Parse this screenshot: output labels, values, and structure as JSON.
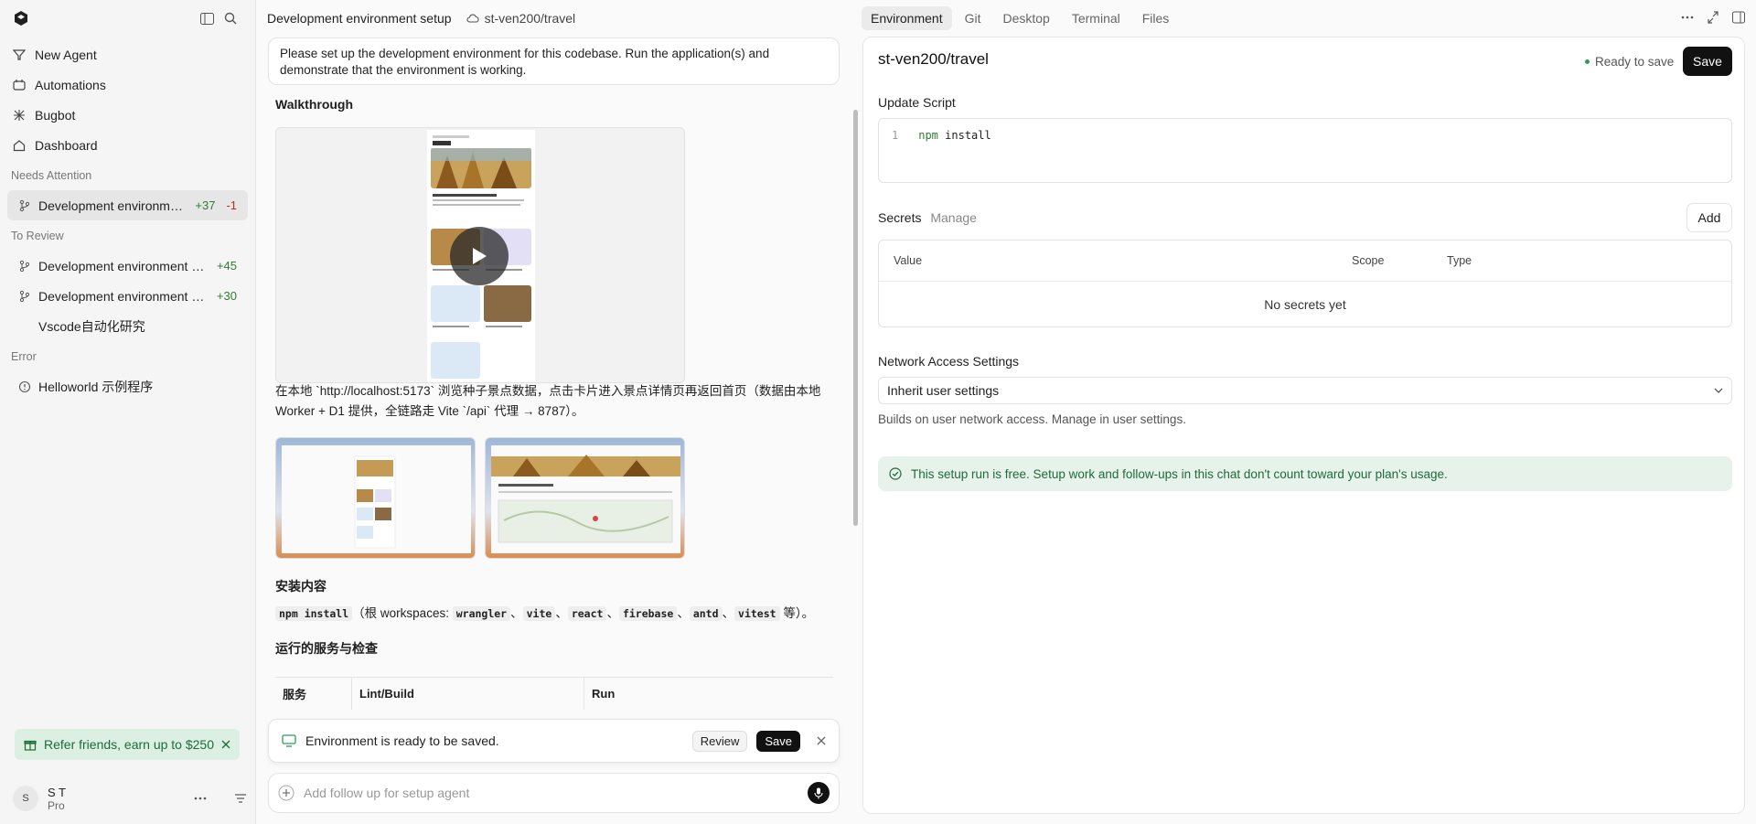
{
  "sidebar": {
    "nav": [
      {
        "label": "New Agent",
        "icon": "agent-icon"
      },
      {
        "label": "Automations",
        "icon": "automations-icon"
      },
      {
        "label": "Bugbot",
        "icon": "bug-icon"
      },
      {
        "label": "Dashboard",
        "icon": "home-icon"
      }
    ],
    "sections": {
      "needs_attention": "Needs Attention",
      "to_review": "To Review",
      "error": "Error"
    },
    "needs_attention_items": [
      {
        "label": "Development environment...",
        "plus": "+37",
        "minus": "-1"
      }
    ],
    "review_items": [
      {
        "label": "Development environment se...",
        "plus": "+45"
      },
      {
        "label": "Development environment se...",
        "plus": "+30"
      },
      {
        "label": "Vscode自动化研究"
      }
    ],
    "error_items": [
      {
        "label": "Helloworld 示例程序"
      }
    ],
    "promo": "Refer friends, earn up to $250",
    "user": {
      "initial": "S",
      "name": "S T",
      "plan": "Pro"
    }
  },
  "chat": {
    "title": "Development environment setup",
    "repo": "st-ven200/travel",
    "prompt": "Please set up the development environment for this codebase. Run the application(s) and demonstrate that the environment is working.",
    "walkthrough_title": "Walkthrough",
    "desc_line1": "在本地 `http://localhost:5173` 浏览种子景点数据，点击卡片进入景点详情页再返回首页（数据由本地",
    "desc_line2": "Worker + D1 提供，全链路走 Vite `/api` 代理 → 8787）。",
    "install_title": "安装内容",
    "install_cmd": "npm install",
    "install_mid": "（根 workspaces:",
    "packages": [
      "wrangler",
      "vite",
      "react",
      "firebase",
      "antd",
      "vitest"
    ],
    "install_end": "等）。",
    "services_title": "运行的服务与检查",
    "table_headers": [
      "服务",
      "Lint/Build",
      "Run"
    ],
    "toast_text": "Environment is ready to be saved.",
    "toast_review": "Review",
    "toast_save": "Save",
    "composer_placeholder": "Add follow up for setup agent"
  },
  "right": {
    "tabs": [
      "Environment",
      "Git",
      "Desktop",
      "Terminal",
      "Files"
    ],
    "title": "st-ven200/travel",
    "status": "Ready to save",
    "save": "Save",
    "update_script_label": "Update Script",
    "script_line_no": "1",
    "script_cmd": "npm",
    "script_arg": "install",
    "secrets_label": "Secrets",
    "secrets_manage": "Manage",
    "add": "Add",
    "secrets_columns": [
      "Value",
      "Scope",
      "Type"
    ],
    "secrets_empty": "No secrets yet",
    "network_label": "Network Access Settings",
    "network_value": "Inherit user settings",
    "network_help": "Builds on user network access. Manage in",
    "network_help_link": "user settings.",
    "banner": "This setup run is free. Setup work and follow-ups in this chat don't count toward your plan's usage."
  },
  "colors": {
    "accent_green": "#2e9e52",
    "banner_bg": "#e6f2ea",
    "promo_bg": "#dcefe3",
    "dark_button": "#111111"
  }
}
